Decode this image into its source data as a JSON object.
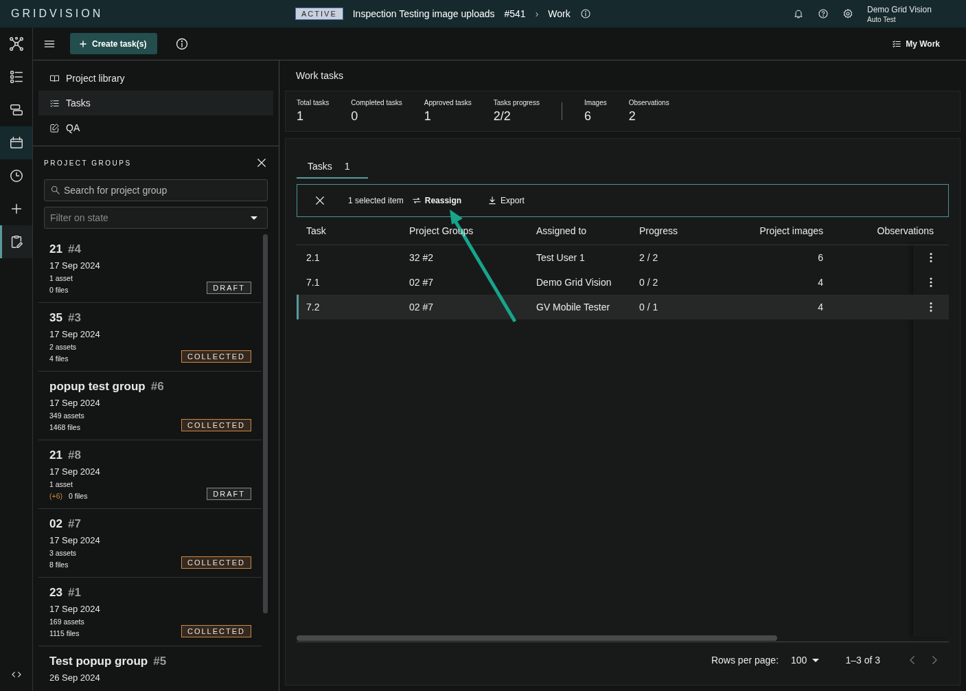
{
  "topbar": {
    "logo": "GRIDVISION",
    "status": "ACTIVE",
    "title": "Inspection Testing image uploads",
    "number": "#541",
    "separator": "›",
    "page": "Work",
    "user": {
      "name": "Demo Grid Vision",
      "org": "Auto Test"
    }
  },
  "rail": [
    {
      "selected": false,
      "highlighted": false
    },
    {
      "selected": false,
      "highlighted": false
    },
    {
      "selected": false,
      "highlighted": false
    },
    {
      "selected": false,
      "highlighted": true
    },
    {
      "selected": false,
      "highlighted": false
    },
    {
      "selected": false,
      "highlighted": false
    },
    {
      "selected": true,
      "highlighted": false
    }
  ],
  "toolbar": {
    "create_button": "Create task(s)",
    "my_work": "My Work"
  },
  "nav": [
    {
      "label": "Project library",
      "selected": false
    },
    {
      "label": "Tasks",
      "selected": true
    },
    {
      "label": "QA",
      "selected": false
    }
  ],
  "project_groups": {
    "title": "PROJECT GROUPS",
    "search": {
      "placeholder": "Search for project group"
    },
    "filter": {
      "placeholder": "Filter on state"
    },
    "items": [
      {
        "name": "21",
        "number": "#4",
        "date": "17 Sep 2024",
        "assets": "1 asset",
        "files": "0 files",
        "badge": "DRAFT",
        "kind": "draft"
      },
      {
        "name": "35",
        "number": "#3",
        "date": "17 Sep 2024",
        "assets": "2 assets",
        "files": "4 files",
        "badge": "COLLECTED",
        "kind": "collected"
      },
      {
        "name": "popup test group",
        "number": "#6",
        "date": "17 Sep 2024",
        "assets": "349 assets",
        "files": "1468 files",
        "badge": "COLLECTED",
        "kind": "collected"
      },
      {
        "name": "21",
        "number": "#8",
        "date": "17 Sep 2024",
        "assets": "1 asset",
        "extra": "(+6)",
        "files": "0 files",
        "badge": "DRAFT",
        "kind": "draft"
      },
      {
        "name": "02",
        "number": "#7",
        "date": "17 Sep 2024",
        "assets": "3 assets",
        "files": "8 files",
        "badge": "COLLECTED",
        "kind": "collected"
      },
      {
        "name": "23",
        "number": "#1",
        "date": "17 Sep 2024",
        "assets": "169 assets",
        "files": "1115 files",
        "badge": "COLLECTED",
        "kind": "collected"
      },
      {
        "name": "Test popup group",
        "number": "#5",
        "date": "26 Sep 2024"
      }
    ]
  },
  "work": {
    "title": "Work tasks",
    "stats": [
      [
        {
          "label": "Total tasks",
          "value": "1"
        },
        {
          "label": "Completed tasks",
          "value": "0"
        },
        {
          "label": "Approved tasks",
          "value": "1"
        },
        {
          "label": "Tasks progress",
          "value": "2/2"
        }
      ],
      [
        {
          "label": "Images",
          "value": "6"
        },
        {
          "label": "Observations",
          "value": "2"
        }
      ]
    ],
    "tabs": [
      {
        "label": "Tasks",
        "count": "1",
        "selected": true
      }
    ],
    "selection": {
      "text": "1 selected item",
      "actions": [
        {
          "label": "Reassign",
          "kind": "reassign"
        },
        {
          "label": "Export",
          "kind": "export"
        }
      ]
    },
    "table": {
      "columns": [
        {
          "label": "Task"
        },
        {
          "label": "Project Groups"
        },
        {
          "label": "Assigned to"
        },
        {
          "label": "Progress"
        },
        {
          "label": "Project images"
        },
        {
          "label": "Observations"
        }
      ],
      "rows": [
        {
          "cells": [
            "2.1",
            "32 #2",
            "Test User 1",
            "2 / 2",
            "6",
            ""
          ],
          "selected": false
        },
        {
          "cells": [
            "7.1",
            "02 #7",
            "Demo Grid Vision",
            "0 / 2",
            "4",
            ""
          ],
          "selected": false
        },
        {
          "cells": [
            "7.2",
            "02 #7",
            "GV Mobile Tester",
            "0 / 1",
            "4",
            ""
          ],
          "selected": true
        }
      ]
    },
    "pagination": {
      "label": "Rows per page:",
      "value": "100",
      "range": "1–3 of 3"
    }
  }
}
